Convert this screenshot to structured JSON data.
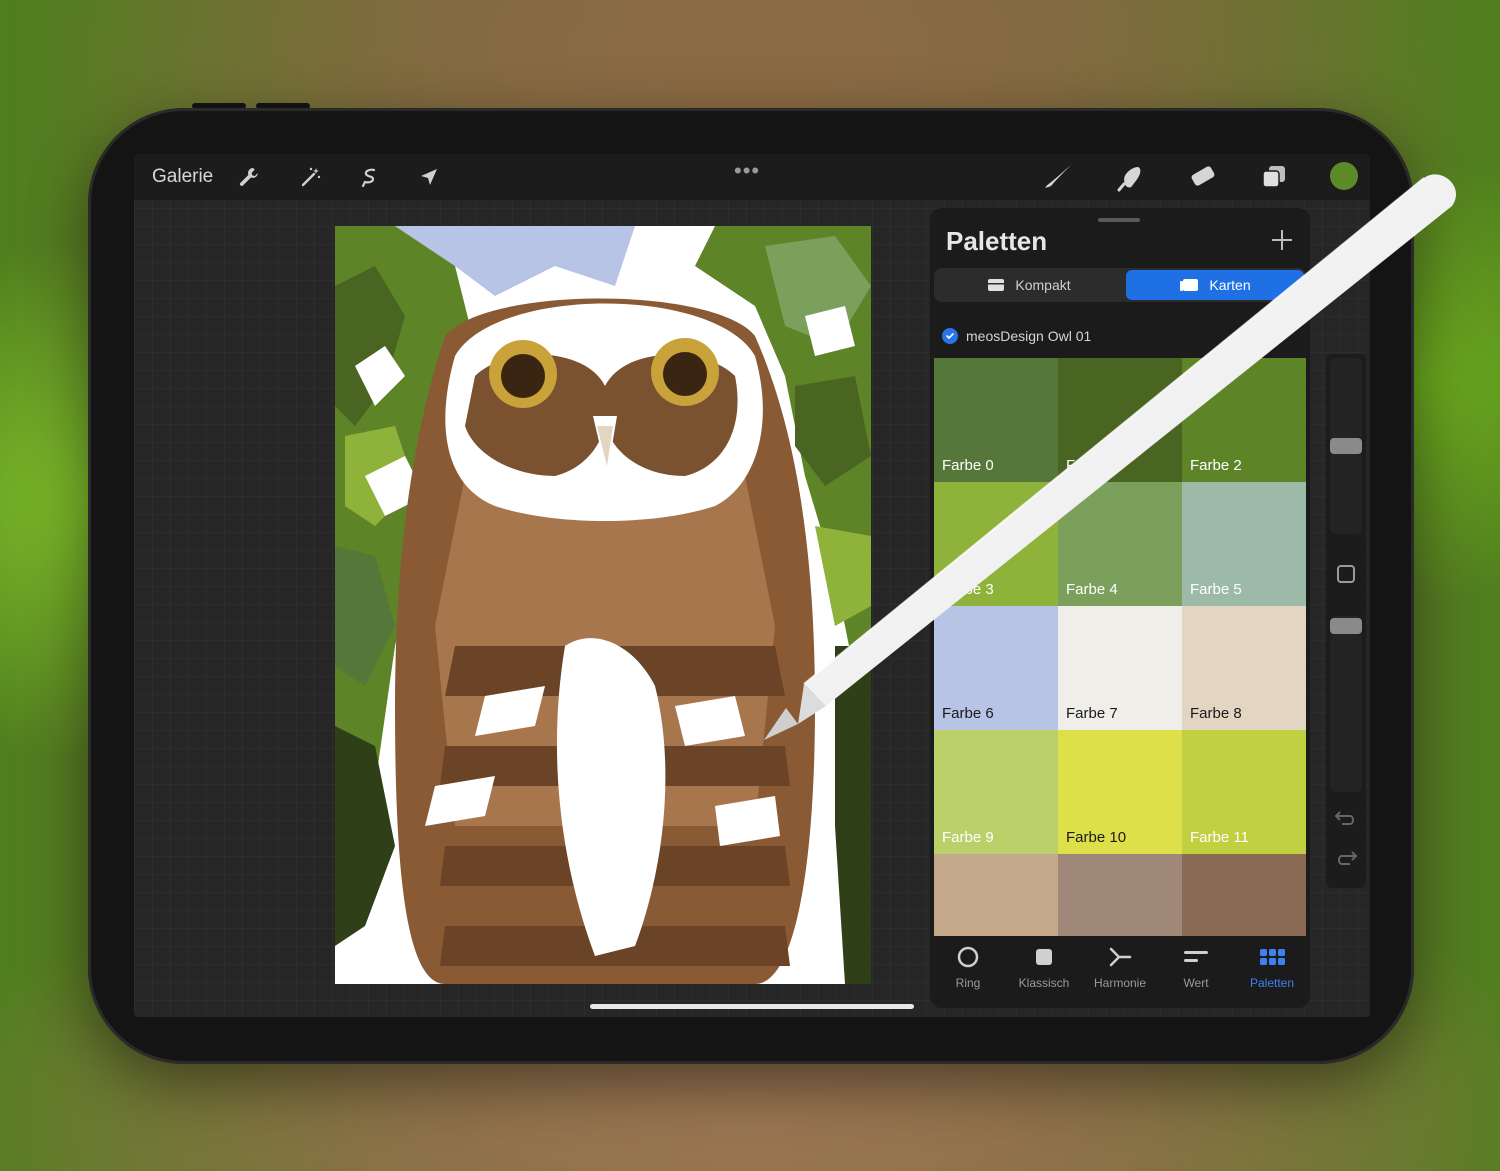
{
  "toolbar": {
    "gallery_label": "Galerie",
    "more_label": "•••",
    "current_color": "#5c8a2a"
  },
  "palettes_panel": {
    "title": "Paletten",
    "view_compact_label": "Kompakt",
    "view_cards_label": "Karten",
    "palette_name": "meosDesign Owl 01",
    "swatches": [
      {
        "label": "Farbe 0",
        "color": "#55773a",
        "text": "#ffffff"
      },
      {
        "label": "Farbe 1",
        "color": "#4a6522",
        "text": "#ffffff"
      },
      {
        "label": "Farbe 2",
        "color": "#5e8428",
        "text": "#ffffff"
      },
      {
        "label": "Farbe 3",
        "color": "#8fb23a",
        "text": "#ffffff"
      },
      {
        "label": "Farbe 4",
        "color": "#7aa05c",
        "text": "#ffffff"
      },
      {
        "label": "Farbe 5",
        "color": "#9dbaa8",
        "text": "#ffffff"
      },
      {
        "label": "Farbe 6",
        "color": "#b8c4e6",
        "text": "#1a1a1a"
      },
      {
        "label": "Farbe 7",
        "color": "#f0eee8",
        "text": "#1a1a1a"
      },
      {
        "label": "Farbe 8",
        "color": "#e2d6c2",
        "text": "#1a1a1a"
      },
      {
        "label": "Farbe 9",
        "color": "#bcd06a",
        "text": "#ffffff"
      },
      {
        "label": "Farbe 10",
        "color": "#dee04a",
        "text": "#1a1a1a"
      },
      {
        "label": "Farbe 11",
        "color": "#c0d040",
        "text": "#ffffff"
      },
      {
        "label": "",
        "color": "#c4a88a",
        "text": "#ffffff"
      },
      {
        "label": "",
        "color": "#a08878",
        "text": "#ffffff"
      },
      {
        "label": "",
        "color": "#8a6a54",
        "text": "#ffffff"
      }
    ],
    "tabs": [
      {
        "label": "Ring",
        "icon": "ring-icon"
      },
      {
        "label": "Klassisch",
        "icon": "square-icon"
      },
      {
        "label": "Harmonie",
        "icon": "harmony-icon"
      },
      {
        "label": "Wert",
        "icon": "sliders-icon"
      },
      {
        "label": "Paletten",
        "icon": "grid-icon"
      }
    ],
    "active_tab": "Paletten"
  }
}
